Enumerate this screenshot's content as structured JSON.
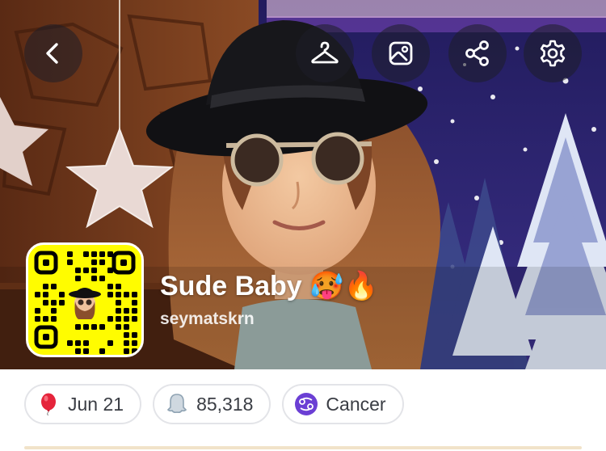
{
  "profile": {
    "display_name": "Sude Baby 🥵🔥",
    "username": "seymatskrn"
  },
  "toolbar": {
    "back_icon": "chevron-left-icon",
    "outfit_icon": "hanger-icon",
    "background_icon": "image-icon",
    "share_icon": "share-icon",
    "settings_icon": "gear-icon"
  },
  "chips": [
    {
      "label": "Jun 21",
      "icon": "balloon-icon"
    },
    {
      "label": "85,318",
      "icon": "ghost-icon"
    },
    {
      "label": "Cancer",
      "icon": "cancer-zodiac-icon"
    }
  ],
  "colors": {
    "snapcode_yellow": "#FFFC00",
    "chip_border": "#e3e4e8",
    "zodiac_purple": "#6b3fd4",
    "balloon_red": "#e5243b"
  }
}
